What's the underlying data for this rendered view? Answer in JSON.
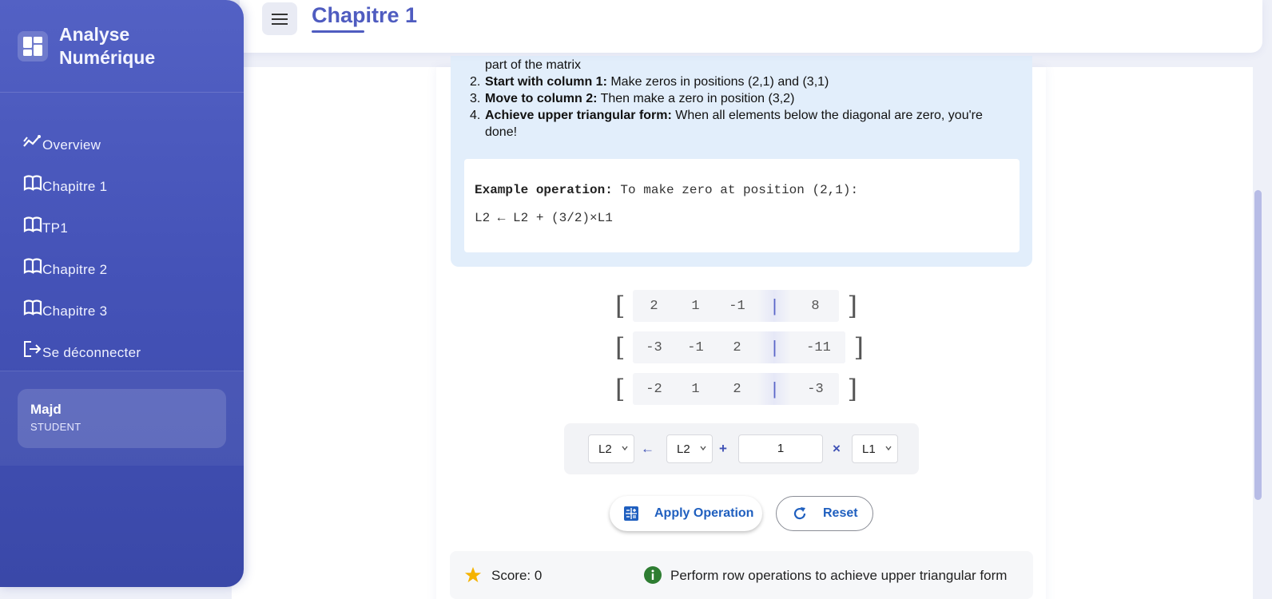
{
  "brand": {
    "line1": "Analyse",
    "line2": "Numérique"
  },
  "nav": [
    {
      "label": "Overview",
      "icon": "chart-trend-icon"
    },
    {
      "label": "Chapitre 1",
      "icon": "book-icon"
    },
    {
      "label": "TP1",
      "icon": "book-icon"
    },
    {
      "label": "Chapitre 2",
      "icon": "book-icon"
    },
    {
      "label": "Chapitre 3",
      "icon": "book-icon"
    },
    {
      "label": "Se déconnecter",
      "icon": "logout-icon"
    }
  ],
  "user": {
    "name": "Majd",
    "role": "STUDENT"
  },
  "header": {
    "title": "Chapitre 1"
  },
  "instructions": {
    "partial_line": "part of the matrix",
    "steps": [
      {
        "num": "2.",
        "bold": "Start with column 1:",
        "text": " Make zeros in positions (2,1) and (3,1)"
      },
      {
        "num": "3.",
        "bold": "Move to column 2:",
        "text": " Then make a zero in position (3,2)"
      },
      {
        "num": "4.",
        "bold": "Achieve upper triangular form:",
        "text": " When all elements below the diagonal are zero, you're done!"
      }
    ],
    "example_label": "Example operation:",
    "example_text": " To make zero at position (2,1):",
    "example_formula": "L2 ← L2 + (3/2)×L1"
  },
  "matrix": {
    "rows": [
      {
        "coeffs": [
          "2",
          "1",
          "-1"
        ],
        "rhs": "8"
      },
      {
        "coeffs": [
          "-3",
          "-1",
          "2"
        ],
        "rhs": "-11"
      },
      {
        "coeffs": [
          "-2",
          "1",
          "2"
        ],
        "rhs": "-3"
      }
    ],
    "open_bracket": "[",
    "close_bracket": "]",
    "separator": "|"
  },
  "operation": {
    "target": "L2",
    "arrow": "←",
    "source": "L2",
    "plus": "+",
    "factor": "1",
    "times": "×",
    "pivot": "L1"
  },
  "buttons": {
    "apply": "Apply Operation",
    "reset": "Reset"
  },
  "status": {
    "score": "Score: 0",
    "hint": "Perform row operations to achieve upper triangular form"
  },
  "colors": {
    "accent": "#4f5cc0",
    "sidebar": "#4553b8",
    "button_text": "#1f5fbf",
    "star": "#f5b301",
    "info": "#2e7d32"
  }
}
